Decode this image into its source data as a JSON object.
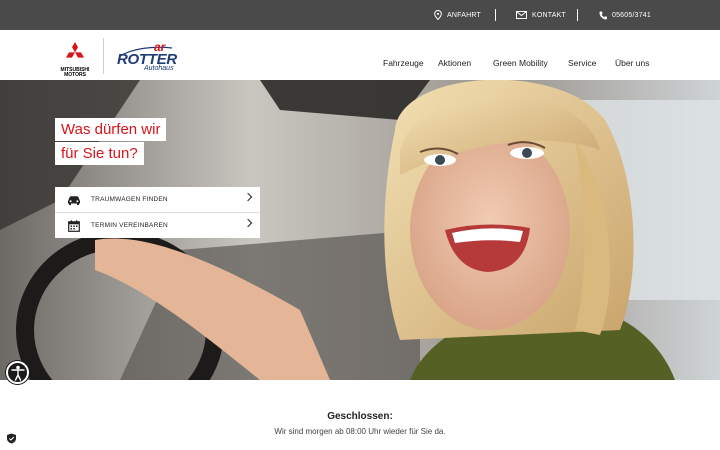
{
  "topbar": {
    "anfahrt": "ANFAHRT",
    "kontakt": "KONTAKT",
    "phone": "05605/3741"
  },
  "logos": {
    "mitsubishi_line1": "MITSUBISHI",
    "mitsubishi_line2": "MOTORS",
    "rotter_ar": "ar",
    "rotter_name": "ROTTER",
    "rotter_sub": "Autohaus"
  },
  "nav": {
    "items": [
      {
        "label": "Fahrzeuge"
      },
      {
        "label": "Aktionen"
      },
      {
        "label": "Green Mobility"
      },
      {
        "label": "Service"
      },
      {
        "label": "Über uns"
      }
    ]
  },
  "hero": {
    "headline_line1": "Was dürfen wir",
    "headline_line2": "für Sie tun?",
    "cta": [
      {
        "label": "TRAUMWAGEN FINDEN",
        "icon": "car-icon"
      },
      {
        "label": "TERMIN VEREINBAREN",
        "icon": "calendar-icon"
      }
    ]
  },
  "status": {
    "title": "Geschlossen:",
    "text": "Wir sind morgen ab 08:00 Uhr wieder für Sie da."
  },
  "colors": {
    "brand_red": "#d7141a",
    "brand_blue": "#1f3b78",
    "topbar_bg": "#4a4a4a"
  }
}
